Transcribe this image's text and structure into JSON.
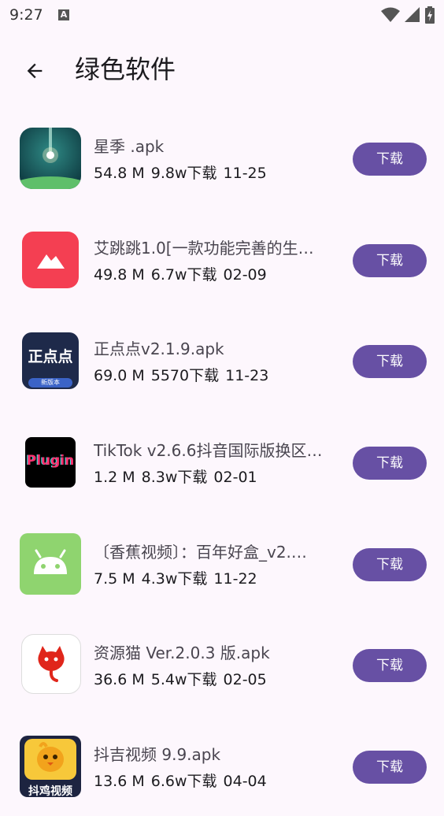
{
  "status_bar": {
    "time": "9:27",
    "a_badge": "A"
  },
  "app_bar": {
    "title": "绿色软件",
    "back_icon": "arrow-left-icon"
  },
  "items": [
    {
      "name": "星季 .apk",
      "size": "54.8 M",
      "downloads": "9.8w下载",
      "date": "11-25",
      "button": "下载",
      "icon": "planet-orb-icon"
    },
    {
      "name": "艾跳跳1.0[一款功能完善的生…",
      "size": "49.8 M",
      "downloads": "6.7w下载",
      "date": "02-09",
      "button": "下载",
      "icon": "mountain-icon"
    },
    {
      "name": "正点点v2.1.9.apk",
      "size": "69.0 M",
      "downloads": "5570下载",
      "date": "11-23",
      "button": "下载",
      "icon": "zhengdiandian-logo-icon",
      "icon_text": "正点点",
      "icon_sub": "新版本"
    },
    {
      "name": "TikTok v2.6.6抖音国际版换区…",
      "size": "1.2 M",
      "downloads": "8.3w下载",
      "date": "02-01",
      "button": "下载",
      "icon": "plugin-logo-icon",
      "icon_text": "Plugin"
    },
    {
      "name": "〔香蕉视频〕：百年好盒_v2.…",
      "size": "7.5 M",
      "downloads": "4.3w下载",
      "date": "11-22",
      "button": "下载",
      "icon": "android-icon"
    },
    {
      "name": "资源猫 Ver.2.0.3 版.apk",
      "size": "36.6 M",
      "downloads": "5.4w下载",
      "date": "02-05",
      "button": "下载",
      "icon": "red-cat-icon"
    },
    {
      "name": "抖吉视频 9.9.apk",
      "size": "13.6 M",
      "downloads": "6.6w下载",
      "date": "04-04",
      "button": "下载",
      "icon": "chick-mascot-icon",
      "icon_text": "抖鸡视频"
    }
  ],
  "colors": {
    "background": "#fdf7fd",
    "button": "#6750a4",
    "button_text": "#ffffff"
  }
}
